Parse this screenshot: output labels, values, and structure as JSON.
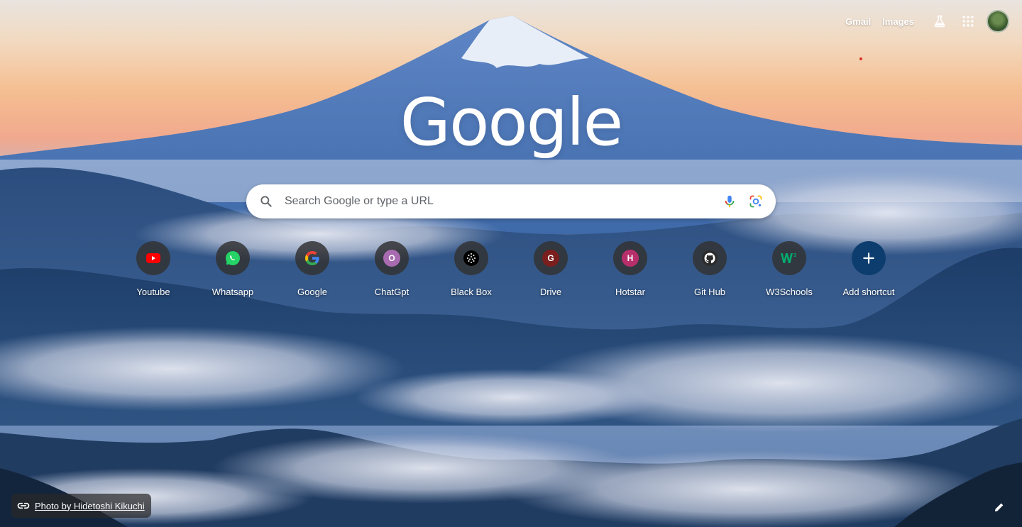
{
  "topbar": {
    "gmail": "Gmail",
    "images": "Images",
    "icons": [
      "labs-flask-icon",
      "apps-grid-icon"
    ]
  },
  "logo": "Google",
  "search": {
    "placeholder": "Search Google or type a URL",
    "icons": [
      "search-icon",
      "mic-icon",
      "lens-icon"
    ]
  },
  "shortcuts": [
    {
      "label": "Youtube",
      "icon": "youtube-icon",
      "color": "#ff0000"
    },
    {
      "label": "Whatsapp",
      "icon": "whatsapp-icon",
      "color": "#25d366"
    },
    {
      "label": "Google",
      "icon": "google-g-icon",
      "color": "#4285f4"
    },
    {
      "label": "ChatGpt",
      "letter": "O",
      "color": "#a86bb0"
    },
    {
      "label": "Black Box",
      "icon": "blackbox-icon",
      "color": "#000000"
    },
    {
      "label": "Drive",
      "letter": "G",
      "color": "#7b1e1e"
    },
    {
      "label": "Hotstar",
      "letter": "H",
      "color": "#b72f6a"
    },
    {
      "label": "Git Hub",
      "icon": "github-icon",
      "color": "#2b2b2b"
    },
    {
      "label": "W3Schools",
      "icon": "w3schools-icon",
      "color": "#04aa6d"
    },
    {
      "label": "Add shortcut",
      "icon": "plus-icon",
      "color": "#0d3d6e"
    }
  ],
  "footer": {
    "credit": "Photo by Hidetoshi Kikuchi",
    "customize_icon": "pencil-icon"
  }
}
